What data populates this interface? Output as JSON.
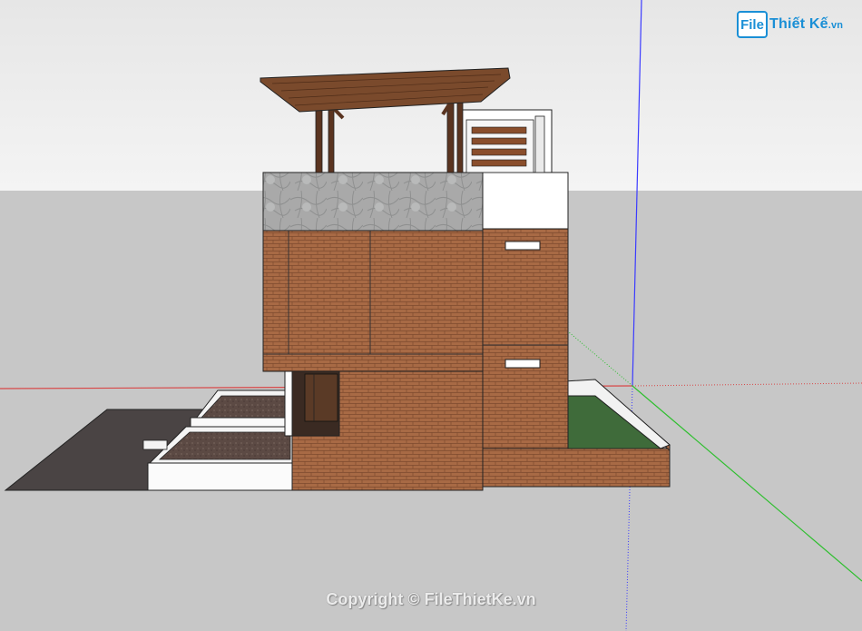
{
  "logo": {
    "box": "File",
    "text": "Thiết Kế",
    "suffix": ".vn"
  },
  "watermark": {
    "text": "Copyright © FileThietKe.vn"
  },
  "colors": {
    "sky_top": "#e6e6e6",
    "sky_bottom": "#f4f4f4",
    "ground": "#c7c7c7",
    "brick": "#a86a45",
    "stone": "#a9a9a9",
    "roof_wood": "#7a4a2c",
    "grass": "#3f6b3a",
    "pavement": "#4a4444",
    "axis_blue": "#3b3bff",
    "axis_red": "#d84848",
    "axis_green": "#2fbf2f"
  }
}
